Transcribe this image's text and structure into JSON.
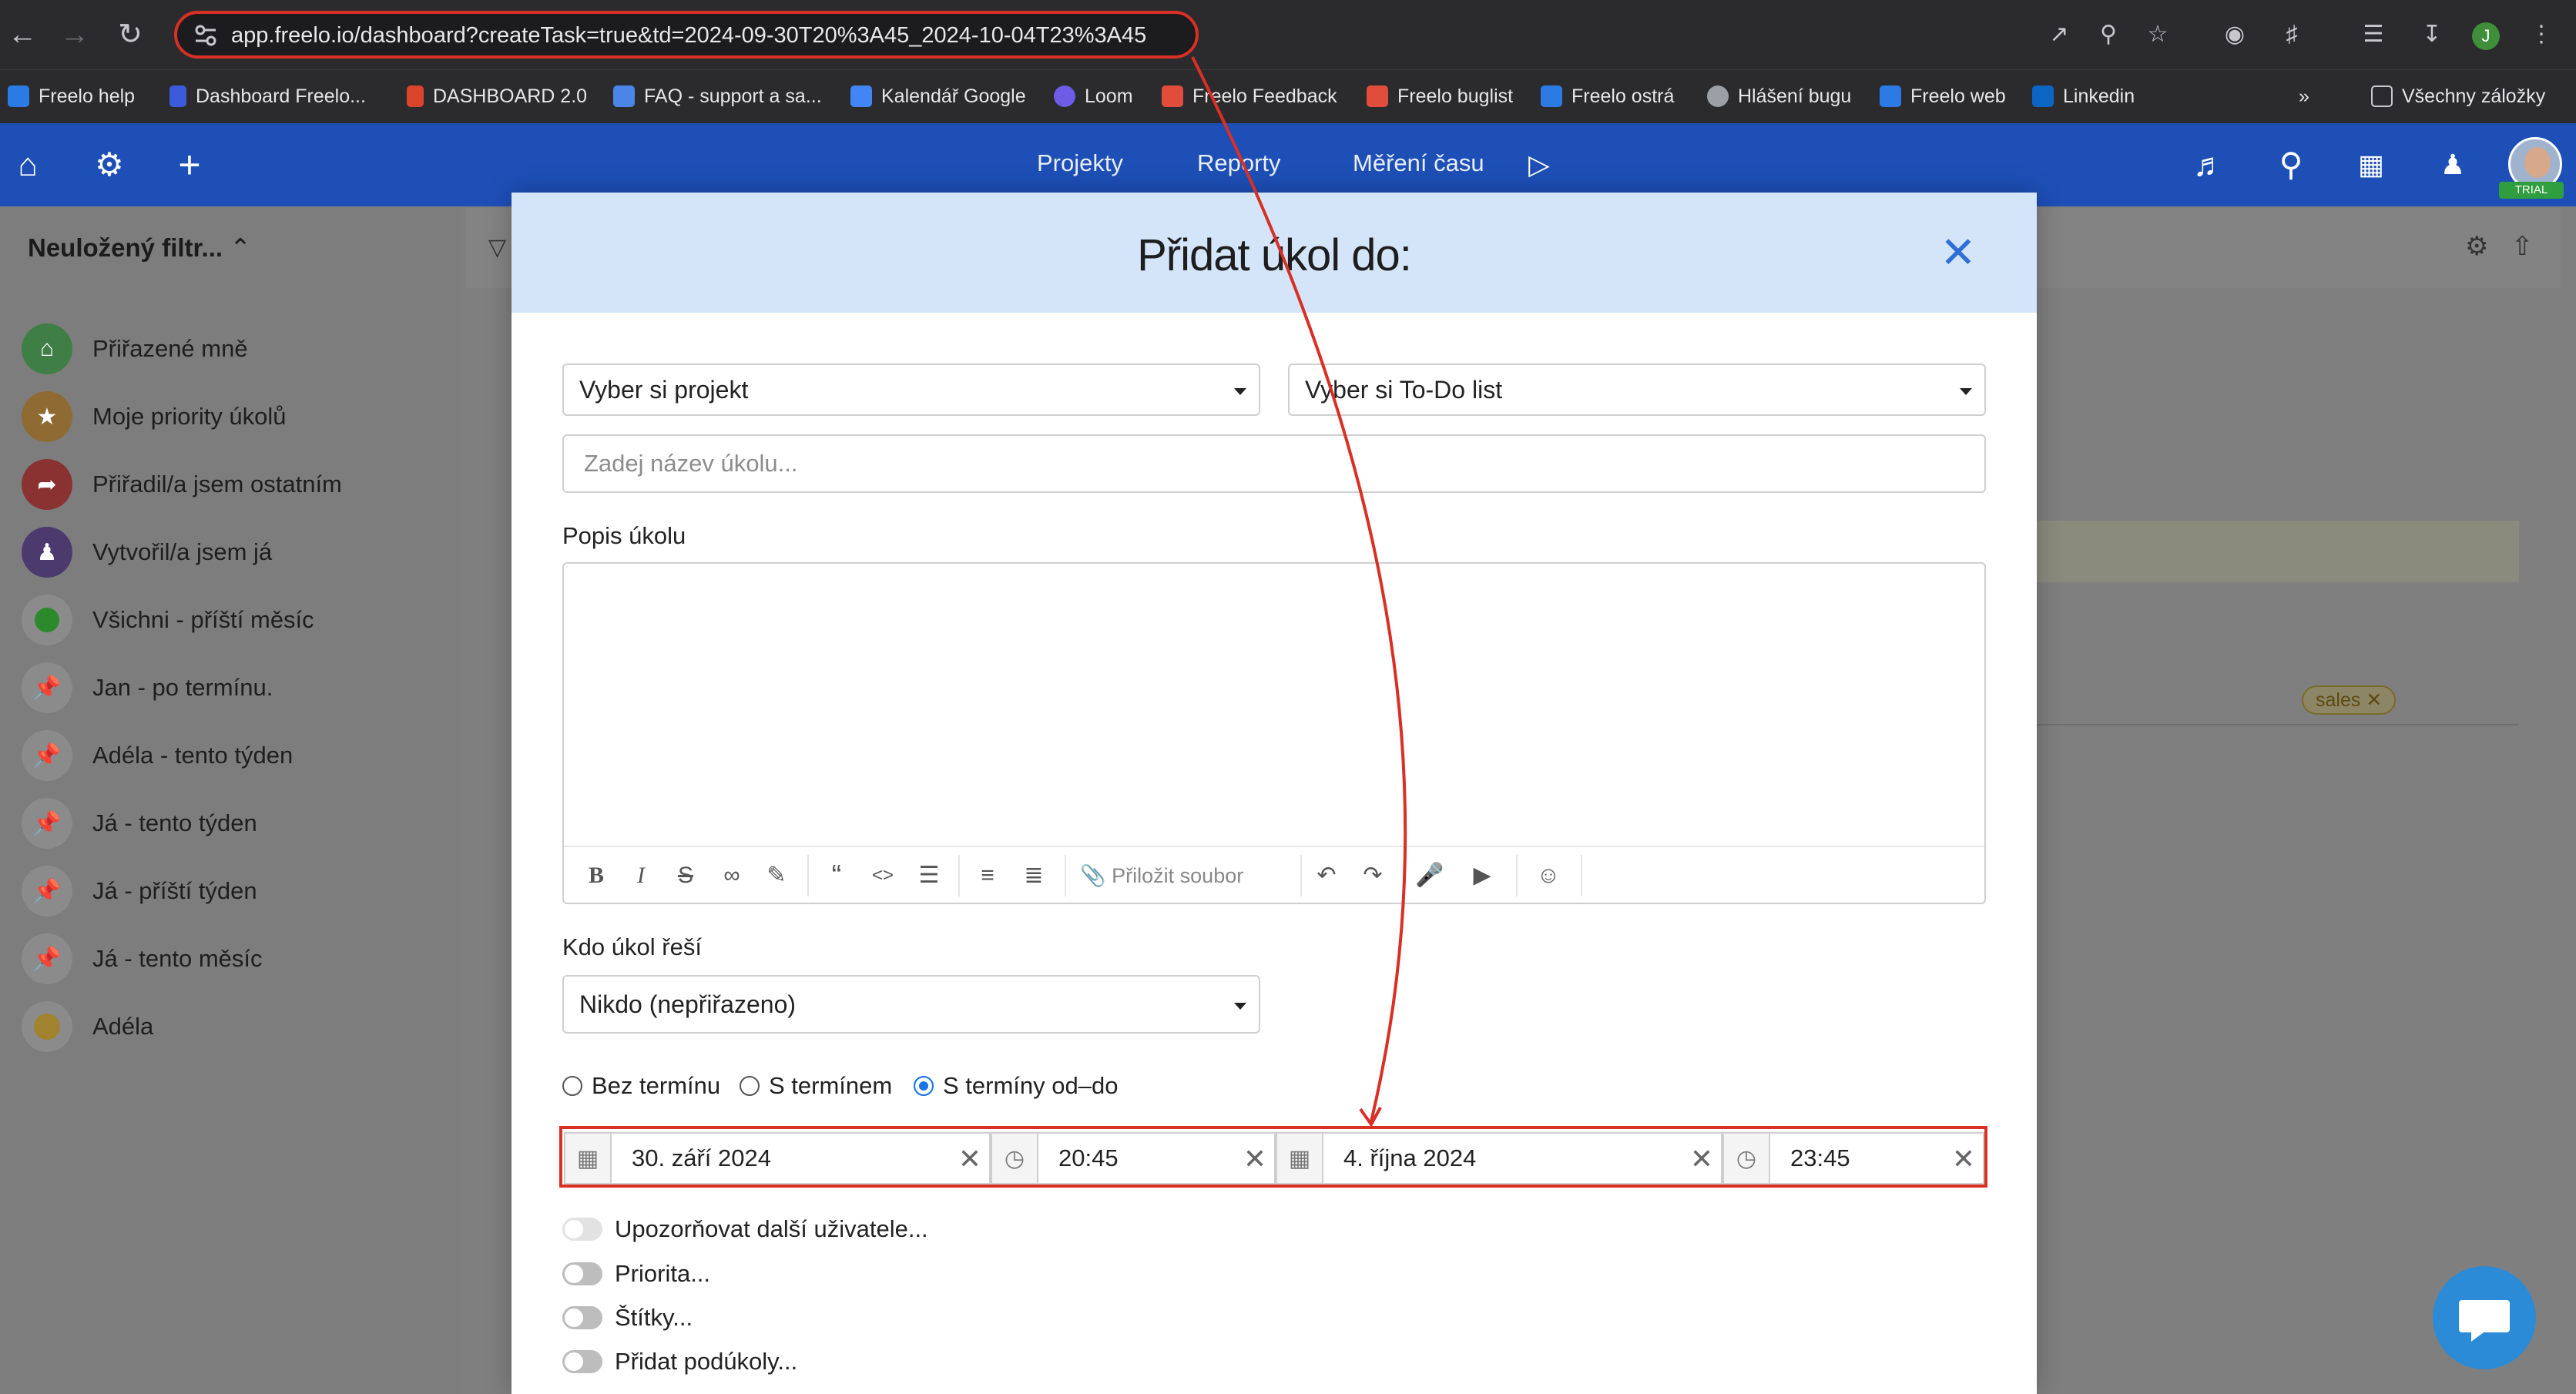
{
  "browser": {
    "url": "app.freelo.io/dashboard?createTask=true&td=2024-09-30T20%3A45_2024-10-04T23%3A45",
    "profile_initial": "J",
    "bookmarks": [
      {
        "label": "Freelo help"
      },
      {
        "label": "Dashboard Freelo..."
      },
      {
        "label": "DASHBOARD 2.0"
      },
      {
        "label": "FAQ - support a sa..."
      },
      {
        "label": "Kalendář Google"
      },
      {
        "label": "Loom"
      },
      {
        "label": "Freelo Feedback"
      },
      {
        "label": "Freelo buglist"
      },
      {
        "label": "Freelo ostrá"
      },
      {
        "label": "Hlášení bugu"
      },
      {
        "label": "Freelo web"
      },
      {
        "label": "Linkedin"
      }
    ],
    "more_bookmarks": "»",
    "all_bookmarks": "Všechny záložky"
  },
  "appbar": {
    "menu": [
      "Projekty",
      "Reporty",
      "Měření času"
    ],
    "avatar_badge": "TRIAL"
  },
  "sidebar": {
    "title": "Neuložený filtr...",
    "items": [
      {
        "label": "Přiřazené mně",
        "color": "#2e9e3e",
        "icon": "home-icon"
      },
      {
        "label": "Moje priority úkolů",
        "color": "#d98b1a",
        "icon": "star-icon"
      },
      {
        "label": "Přiřadil/a jsem ostatním",
        "color": "#c0292a",
        "icon": "share-arrow-icon"
      },
      {
        "label": "Vytvořil/a jsem já",
        "color": "#5b2d9a",
        "icon": "user-icon"
      },
      {
        "label": "Všichni - příští měsíc",
        "color": "#2aa82a",
        "icon": "green-dot-icon"
      },
      {
        "label": "Jan - po termínu.",
        "color": "#c62828",
        "icon": "pin-icon"
      },
      {
        "label": "Adéla - tento týden",
        "color": "#c62828",
        "icon": "pin-icon"
      },
      {
        "label": "Já - tento týden",
        "color": "#c62828",
        "icon": "pin-icon"
      },
      {
        "label": "Já - příští týden",
        "color": "#c62828",
        "icon": "pin-icon"
      },
      {
        "label": "Já - tento měsíc",
        "color": "#c62828",
        "icon": "pin-icon"
      },
      {
        "label": "Adéla",
        "color": "#e5b83a",
        "icon": "smiley-icon"
      }
    ]
  },
  "background": {
    "tag": "sales"
  },
  "modal": {
    "title": "Přidat úkol do:",
    "project_select": "Vyber si projekt",
    "todo_select": "Vyber si To-Do list",
    "task_name_placeholder": "Zadej název úkolu...",
    "description_label": "Popis úkolu",
    "attach_label": "Přiložit soubor",
    "assignee_label": "Kdo úkol řeší",
    "assignee_value": "Nikdo (nepřiřazeno)",
    "deadline_options": [
      {
        "label": "Bez termínu",
        "checked": false
      },
      {
        "label": "S termínem",
        "checked": false
      },
      {
        "label": "S termíny od–do",
        "checked": true
      }
    ],
    "date_from": "30. září 2024",
    "time_from": "20:45",
    "date_to": "4. října 2024",
    "time_to": "23:45",
    "toggles": [
      {
        "label": "Upozorňovat další uživatele..."
      },
      {
        "label": "Priorita..."
      },
      {
        "label": "Štítky..."
      },
      {
        "label": "Přidat podúkoly..."
      }
    ]
  },
  "colors": {
    "appbar": "#1d4fb6",
    "modal_header": "#d4e5f9",
    "highlight": "#d93025",
    "radio_selected": "#1a73e8"
  }
}
